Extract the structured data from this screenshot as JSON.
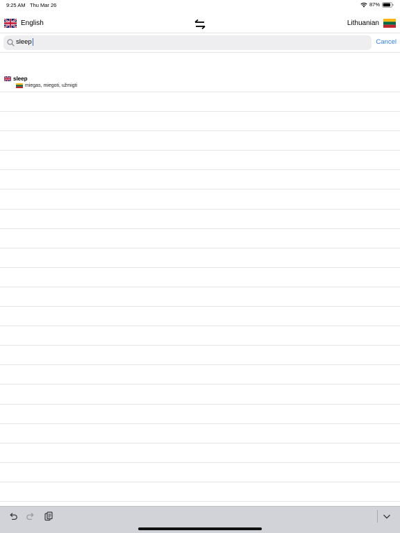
{
  "status_bar": {
    "time": "9:25 AM",
    "date": "Thu Mar 26",
    "battery": "87%",
    "icons": [
      "wifi-icon",
      "battery-icon"
    ]
  },
  "language_bar": {
    "source_language": "English",
    "target_language": "Lithuanian",
    "swap_icon": "swap-arrows-icon"
  },
  "search": {
    "query": "sleep",
    "cancel_label": "Cancel",
    "icon": "magnifier-icon"
  },
  "results": [
    {
      "word": "sleep",
      "translation": "miegas, miegoti, užmigti"
    }
  ],
  "toolbar": {
    "icons": [
      "undo-icon",
      "redo-icon",
      "paste-icon",
      "chevron-down-icon"
    ]
  },
  "colors": {
    "accent": "#2f7ef0",
    "toolbar_bg": "#d2d3d8",
    "search_bg": "#eeeef0"
  }
}
